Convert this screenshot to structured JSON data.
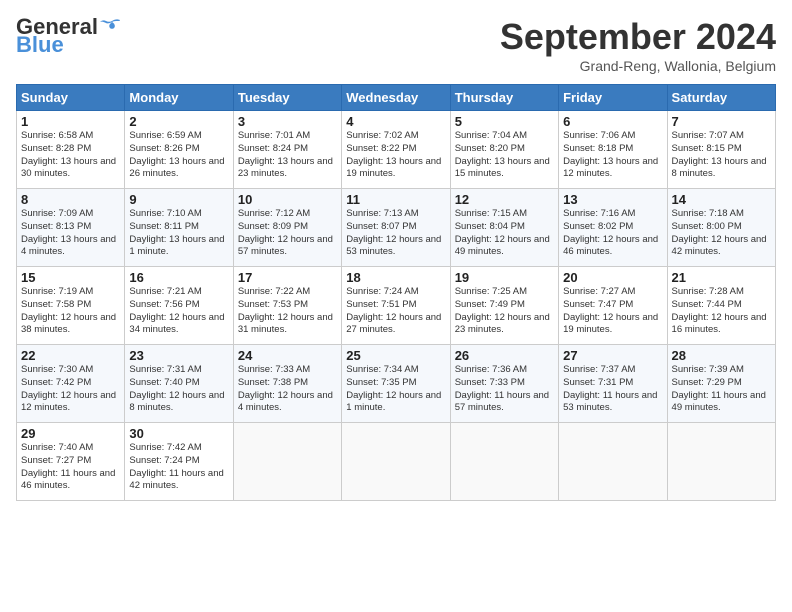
{
  "header": {
    "logo_line1": "General",
    "logo_line2": "Blue",
    "month_title": "September 2024",
    "subtitle": "Grand-Reng, Wallonia, Belgium"
  },
  "weekdays": [
    "Sunday",
    "Monday",
    "Tuesday",
    "Wednesday",
    "Thursday",
    "Friday",
    "Saturday"
  ],
  "weeks": [
    [
      {
        "day": "1",
        "sunrise": "Sunrise: 6:58 AM",
        "sunset": "Sunset: 8:28 PM",
        "daylight": "Daylight: 13 hours and 30 minutes."
      },
      {
        "day": "2",
        "sunrise": "Sunrise: 6:59 AM",
        "sunset": "Sunset: 8:26 PM",
        "daylight": "Daylight: 13 hours and 26 minutes."
      },
      {
        "day": "3",
        "sunrise": "Sunrise: 7:01 AM",
        "sunset": "Sunset: 8:24 PM",
        "daylight": "Daylight: 13 hours and 23 minutes."
      },
      {
        "day": "4",
        "sunrise": "Sunrise: 7:02 AM",
        "sunset": "Sunset: 8:22 PM",
        "daylight": "Daylight: 13 hours and 19 minutes."
      },
      {
        "day": "5",
        "sunrise": "Sunrise: 7:04 AM",
        "sunset": "Sunset: 8:20 PM",
        "daylight": "Daylight: 13 hours and 15 minutes."
      },
      {
        "day": "6",
        "sunrise": "Sunrise: 7:06 AM",
        "sunset": "Sunset: 8:18 PM",
        "daylight": "Daylight: 13 hours and 12 minutes."
      },
      {
        "day": "7",
        "sunrise": "Sunrise: 7:07 AM",
        "sunset": "Sunset: 8:15 PM",
        "daylight": "Daylight: 13 hours and 8 minutes."
      }
    ],
    [
      {
        "day": "8",
        "sunrise": "Sunrise: 7:09 AM",
        "sunset": "Sunset: 8:13 PM",
        "daylight": "Daylight: 13 hours and 4 minutes."
      },
      {
        "day": "9",
        "sunrise": "Sunrise: 7:10 AM",
        "sunset": "Sunset: 8:11 PM",
        "daylight": "Daylight: 13 hours and 1 minute."
      },
      {
        "day": "10",
        "sunrise": "Sunrise: 7:12 AM",
        "sunset": "Sunset: 8:09 PM",
        "daylight": "Daylight: 12 hours and 57 minutes."
      },
      {
        "day": "11",
        "sunrise": "Sunrise: 7:13 AM",
        "sunset": "Sunset: 8:07 PM",
        "daylight": "Daylight: 12 hours and 53 minutes."
      },
      {
        "day": "12",
        "sunrise": "Sunrise: 7:15 AM",
        "sunset": "Sunset: 8:04 PM",
        "daylight": "Daylight: 12 hours and 49 minutes."
      },
      {
        "day": "13",
        "sunrise": "Sunrise: 7:16 AM",
        "sunset": "Sunset: 8:02 PM",
        "daylight": "Daylight: 12 hours and 46 minutes."
      },
      {
        "day": "14",
        "sunrise": "Sunrise: 7:18 AM",
        "sunset": "Sunset: 8:00 PM",
        "daylight": "Daylight: 12 hours and 42 minutes."
      }
    ],
    [
      {
        "day": "15",
        "sunrise": "Sunrise: 7:19 AM",
        "sunset": "Sunset: 7:58 PM",
        "daylight": "Daylight: 12 hours and 38 minutes."
      },
      {
        "day": "16",
        "sunrise": "Sunrise: 7:21 AM",
        "sunset": "Sunset: 7:56 PM",
        "daylight": "Daylight: 12 hours and 34 minutes."
      },
      {
        "day": "17",
        "sunrise": "Sunrise: 7:22 AM",
        "sunset": "Sunset: 7:53 PM",
        "daylight": "Daylight: 12 hours and 31 minutes."
      },
      {
        "day": "18",
        "sunrise": "Sunrise: 7:24 AM",
        "sunset": "Sunset: 7:51 PM",
        "daylight": "Daylight: 12 hours and 27 minutes."
      },
      {
        "day": "19",
        "sunrise": "Sunrise: 7:25 AM",
        "sunset": "Sunset: 7:49 PM",
        "daylight": "Daylight: 12 hours and 23 minutes."
      },
      {
        "day": "20",
        "sunrise": "Sunrise: 7:27 AM",
        "sunset": "Sunset: 7:47 PM",
        "daylight": "Daylight: 12 hours and 19 minutes."
      },
      {
        "day": "21",
        "sunrise": "Sunrise: 7:28 AM",
        "sunset": "Sunset: 7:44 PM",
        "daylight": "Daylight: 12 hours and 16 minutes."
      }
    ],
    [
      {
        "day": "22",
        "sunrise": "Sunrise: 7:30 AM",
        "sunset": "Sunset: 7:42 PM",
        "daylight": "Daylight: 12 hours and 12 minutes."
      },
      {
        "day": "23",
        "sunrise": "Sunrise: 7:31 AM",
        "sunset": "Sunset: 7:40 PM",
        "daylight": "Daylight: 12 hours and 8 minutes."
      },
      {
        "day": "24",
        "sunrise": "Sunrise: 7:33 AM",
        "sunset": "Sunset: 7:38 PM",
        "daylight": "Daylight: 12 hours and 4 minutes."
      },
      {
        "day": "25",
        "sunrise": "Sunrise: 7:34 AM",
        "sunset": "Sunset: 7:35 PM",
        "daylight": "Daylight: 12 hours and 1 minute."
      },
      {
        "day": "26",
        "sunrise": "Sunrise: 7:36 AM",
        "sunset": "Sunset: 7:33 PM",
        "daylight": "Daylight: 11 hours and 57 minutes."
      },
      {
        "day": "27",
        "sunrise": "Sunrise: 7:37 AM",
        "sunset": "Sunset: 7:31 PM",
        "daylight": "Daylight: 11 hours and 53 minutes."
      },
      {
        "day": "28",
        "sunrise": "Sunrise: 7:39 AM",
        "sunset": "Sunset: 7:29 PM",
        "daylight": "Daylight: 11 hours and 49 minutes."
      }
    ],
    [
      {
        "day": "29",
        "sunrise": "Sunrise: 7:40 AM",
        "sunset": "Sunset: 7:27 PM",
        "daylight": "Daylight: 11 hours and 46 minutes."
      },
      {
        "day": "30",
        "sunrise": "Sunrise: 7:42 AM",
        "sunset": "Sunset: 7:24 PM",
        "daylight": "Daylight: 11 hours and 42 minutes."
      },
      null,
      null,
      null,
      null,
      null
    ]
  ]
}
